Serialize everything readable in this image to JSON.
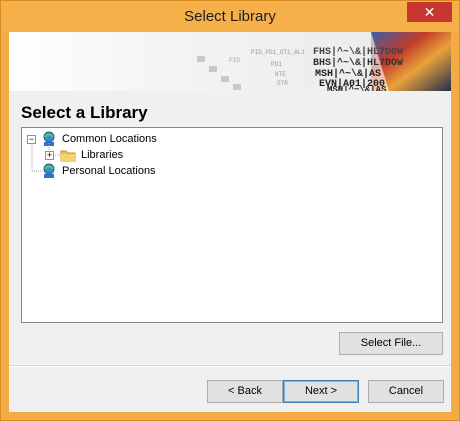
{
  "window": {
    "title": "Select Library",
    "close_glyph": "✕"
  },
  "banner": {
    "decor_text": [
      "FHS|^~\\&|HL7DOW",
      "BHS|^~\\&|HL7DOW",
      "MSH|^~\\&|AS",
      "EVN|A01|200",
      "MSH|^~\\&|AS",
      "PID_PD1_OT1_AL1",
      "PD1",
      "NTE",
      "OTR",
      "PID"
    ]
  },
  "heading": "Select a Library",
  "tree": {
    "nodes": [
      {
        "label": "Common Locations",
        "icon": "network-globe-icon",
        "expanded": true
      },
      {
        "label": "Libraries",
        "icon": "folder-icon",
        "expanded": false
      },
      {
        "label": "Personal Locations",
        "icon": "network-globe-icon"
      }
    ]
  },
  "buttons": {
    "select_file": "Select File...",
    "back": "< Back",
    "next": "Next >",
    "cancel": "Cancel"
  },
  "colors": {
    "titlebar": "#f5b049",
    "close": "#c7372f",
    "selection_hint": "#3c7fb1"
  }
}
